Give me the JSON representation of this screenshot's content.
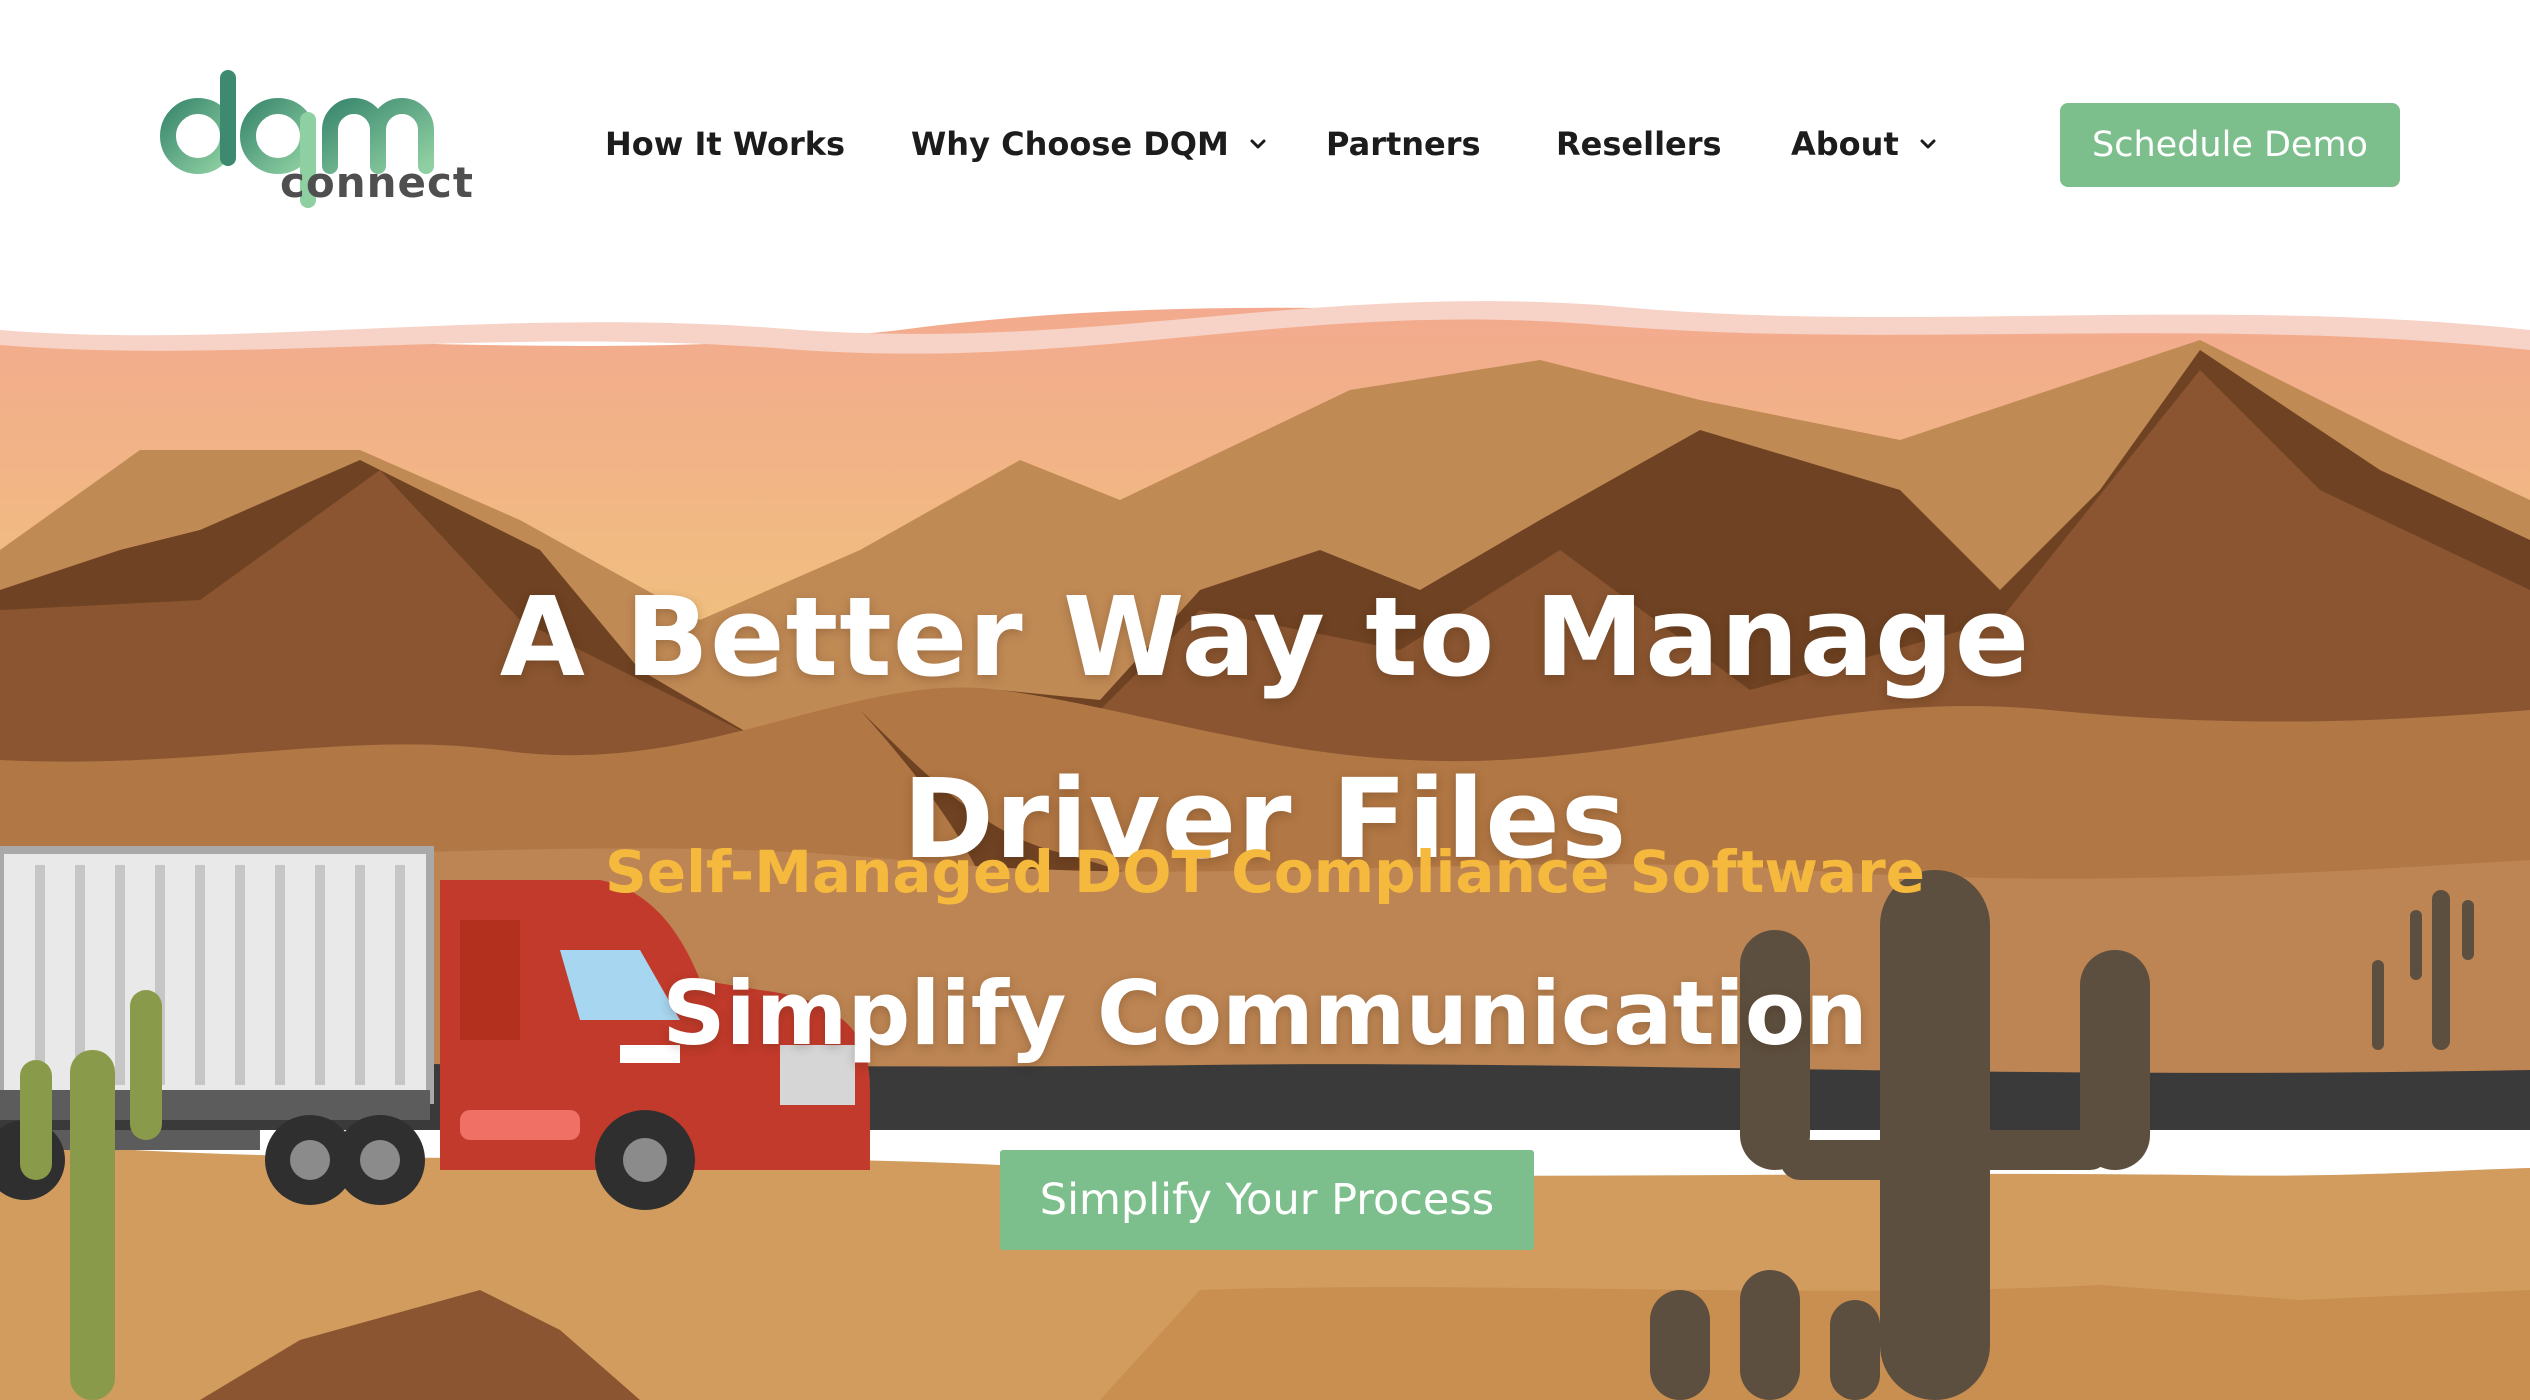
{
  "brand": {
    "logo_mark": "dqm",
    "logo_word": "connect",
    "colors": {
      "accent": "#7dbf8c",
      "logo_green_dark": "#3d8a70",
      "logo_green_light": "#8fd0a2",
      "headline_yellow": "#f5b93e",
      "nav_text": "#1c1c1c"
    }
  },
  "nav": {
    "items": [
      {
        "label": "How It Works",
        "has_dropdown": false
      },
      {
        "label": "Why Choose DQM",
        "has_dropdown": true
      },
      {
        "label": "Partners",
        "has_dropdown": false
      },
      {
        "label": "Resellers",
        "has_dropdown": false
      },
      {
        "label": "About",
        "has_dropdown": true
      }
    ],
    "cta_label": "Schedule Demo"
  },
  "hero": {
    "title": "A Better Way to Manage Driver Files",
    "subtitle": "Self-Managed DOT Compliance Software",
    "rotating_text": "Simplify Communication",
    "cta_label": "Simplify Your Process"
  },
  "icons": [
    "chevron-down-icon"
  ]
}
